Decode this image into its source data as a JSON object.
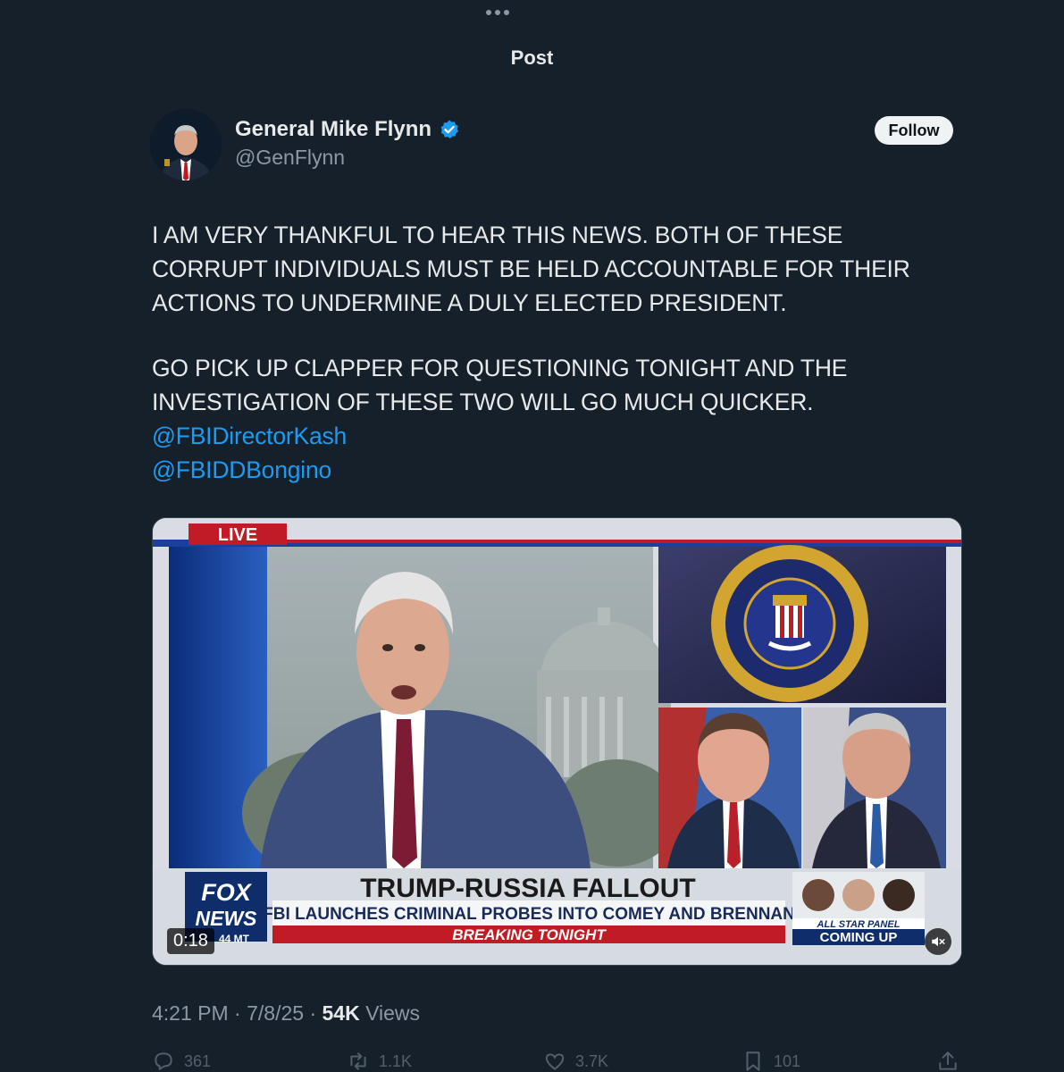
{
  "header": {
    "title": "Post"
  },
  "author": {
    "name": "General Mike Flynn",
    "handle": "@GenFlynn",
    "verified": true,
    "follow_label": "Follow"
  },
  "tweet": {
    "paragraph1": [
      "I AM VERY THANKFUL TO HEAR THIS NEWS. BOTH OF THESE",
      "CORRUPT INDIVIDUALS MUST BE HELD ACCOUNTABLE FOR THEIR",
      "ACTIONS TO UNDERMINE A DULY ELECTED PRESIDENT."
    ],
    "paragraph2": [
      "GO PICK UP CLAPPER FOR QUESTIONING TONIGHT AND THE",
      "INVESTIGATION OF THESE TWO WILL GO MUCH QUICKER."
    ],
    "mentions": [
      "@FBIDirectorKash",
      "@FBIDDBongino"
    ]
  },
  "video": {
    "duration": "0:18",
    "live_label": "LIVE",
    "network": {
      "line1": "FOX",
      "line2": "NEWS"
    },
    "clock": "44 MT",
    "headline": "TRUMP-RUSSIA FALLOUT",
    "subheadline": "FBI LAUNCHES CRIMINAL PROBES INTO COMEY AND BRENNAN",
    "banner": "BREAKING TONIGHT",
    "promo_line1": "ALL STAR PANEL",
    "promo_line2": "COMING UP",
    "seal_text": "DEPARTMENT OF JUSTICE · FEDERAL BUREAU OF INVESTIGATION"
  },
  "meta": {
    "time": "4:21 PM",
    "date": "7/8/25",
    "views_count": "54K",
    "views_label": "Views",
    "separator": "·"
  },
  "actions": {
    "replies": "361",
    "reposts": "1.1K",
    "likes": "3.7K",
    "bookmarks": "101"
  },
  "colors": {
    "background": "#15202b",
    "accent": "#1d9bf0",
    "text": "#e7e9ea",
    "secondary": "#8b98a5"
  }
}
